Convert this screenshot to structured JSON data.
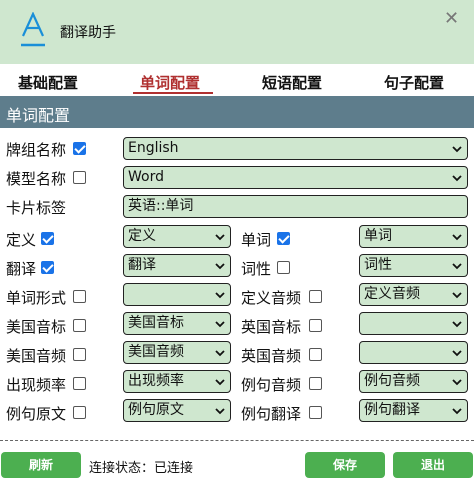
{
  "app": {
    "title": "翻译助手"
  },
  "tabs": [
    {
      "label": "基础配置"
    },
    {
      "label": "单词配置"
    },
    {
      "label": "短语配置"
    },
    {
      "label": "句子配置"
    }
  ],
  "section": {
    "title": "单词配置"
  },
  "fields": {
    "deck_name": {
      "label": "牌组名称",
      "checked": true,
      "value": "English"
    },
    "model_name": {
      "label": "模型名称",
      "checked": false,
      "value": "Word"
    },
    "card_tags": {
      "label": "卡片标签",
      "value": "英语::单词"
    }
  },
  "mappings": [
    {
      "label": "定义",
      "checked": true,
      "value": "定义"
    },
    {
      "label": "单词",
      "checked": true,
      "value": "单词"
    },
    {
      "label": "翻译",
      "checked": true,
      "value": "翻译"
    },
    {
      "label": "词性",
      "checked": false,
      "value": "词性"
    },
    {
      "label": "单词形式",
      "checked": false,
      "value": ""
    },
    {
      "label": "定义音频",
      "checked": false,
      "value": "定义音频"
    },
    {
      "label": "美国音标",
      "checked": false,
      "value": "美国音标"
    },
    {
      "label": "英国音标",
      "checked": false,
      "value": ""
    },
    {
      "label": "美国音频",
      "checked": false,
      "value": "美国音频"
    },
    {
      "label": "英国音频",
      "checked": false,
      "value": ""
    },
    {
      "label": "出现频率",
      "checked": false,
      "value": "出现频率"
    },
    {
      "label": "例句音频",
      "checked": false,
      "value": "例句音频"
    },
    {
      "label": "例句原文",
      "checked": false,
      "value": "例句原文"
    },
    {
      "label": "例句翻译",
      "checked": false,
      "value": "例句翻译"
    }
  ],
  "footer": {
    "refresh_label": "刷新",
    "status_text": "连接状态：已连接",
    "save_label": "保存",
    "exit_label": "退出"
  },
  "colors": {
    "header_bg": "#cfe7cf",
    "section_bg": "#5e7d8c",
    "active_tab": "#b03030",
    "field_bg": "#cfe7cf",
    "button_bg": "#4caf50",
    "logo": "#1a8fd8"
  }
}
